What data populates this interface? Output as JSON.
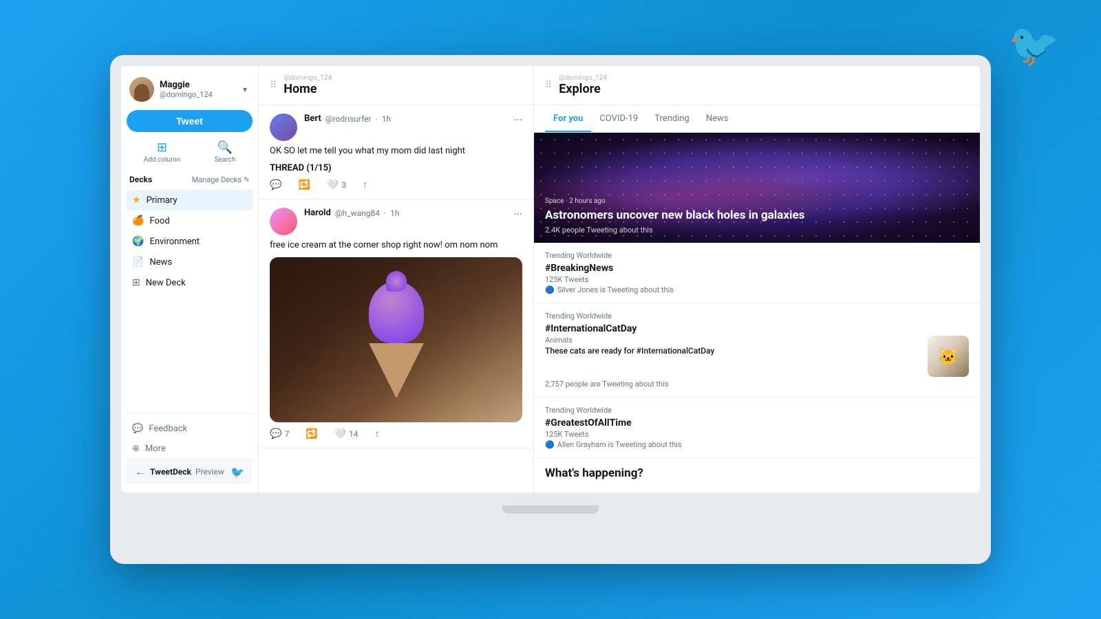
{
  "background": {
    "color": "#1da1f2"
  },
  "twitter_logo": "🐦",
  "sidebar": {
    "user": {
      "display_name": "Maggie",
      "username": "@domingo_124"
    },
    "tweet_button": "Tweet",
    "add_column_label": "Add column",
    "search_label": "Search",
    "decks_title": "Decks",
    "manage_decks_label": "Manage Decks",
    "deck_items": [
      {
        "id": "primary",
        "label": "Primary",
        "icon": "★",
        "active": true
      },
      {
        "id": "food",
        "label": "Food",
        "icon": "🍊"
      },
      {
        "id": "environment",
        "label": "Environment",
        "icon": "🌍"
      },
      {
        "id": "news",
        "label": "News",
        "icon": "📄"
      },
      {
        "id": "new-deck",
        "label": "New Deck",
        "icon": "+"
      }
    ],
    "bottom_items": [
      {
        "id": "feedback",
        "label": "Feedback",
        "icon": "💬"
      },
      {
        "id": "more",
        "label": "More",
        "icon": "⊕"
      }
    ],
    "footer": {
      "back_icon": "←",
      "brand": "TweetDeck",
      "preview": "Preview",
      "twitter_icon": "🐦"
    }
  },
  "home_column": {
    "column_user": "@domingo_124",
    "title": "Home",
    "tweets": [
      {
        "id": "tweet1",
        "author": "Bert",
        "handle": "@rodrisurfer",
        "time": "1h",
        "text": "OK SO let me tell you what my mom did last night",
        "thread": "THREAD (1/15)",
        "replies": "",
        "retweets": "",
        "likes": "3",
        "has_image": false
      },
      {
        "id": "tweet2",
        "author": "Harold",
        "handle": "@h_wang84",
        "time": "1h",
        "text": "free ice cream at the corner shop right now! om nom nom",
        "thread": "",
        "replies": "7",
        "retweets": "",
        "likes": "14",
        "has_image": true
      }
    ]
  },
  "explore_column": {
    "column_user": "@domingo_124",
    "title": "Explore",
    "tabs": [
      {
        "id": "for-you",
        "label": "For you",
        "active": true
      },
      {
        "id": "covid",
        "label": "COVID-19"
      },
      {
        "id": "trending",
        "label": "Trending"
      },
      {
        "id": "news",
        "label": "News"
      }
    ],
    "hero": {
      "tag": "Space · 2 hours ago",
      "title": "Astronomers uncover new black holes in galaxies",
      "stat": "2.4K people Tweeting about this"
    },
    "trends": [
      {
        "id": "breaking",
        "label": "Trending Worldwide",
        "hashtag": "#BreakingNews",
        "count": "125K Tweets",
        "note": "Silver Jones is Tweeting about this",
        "has_image": false
      },
      {
        "id": "catday",
        "label": "Trending Worldwide",
        "hashtag": "#InternationalCatDay",
        "context": "Animals",
        "article_title": "These cats are ready for #InternationalCatDay",
        "count": "",
        "note": "",
        "people": "2,757 people are Tweeting about this",
        "has_image": true
      },
      {
        "id": "greatest",
        "label": "Trending Worldwide",
        "hashtag": "#GreatestOfAllTime",
        "count": "125K Tweets",
        "note": "Allen Grayham is Tweeting about this",
        "has_image": false
      }
    ],
    "whats_happening": "What's happening?"
  }
}
